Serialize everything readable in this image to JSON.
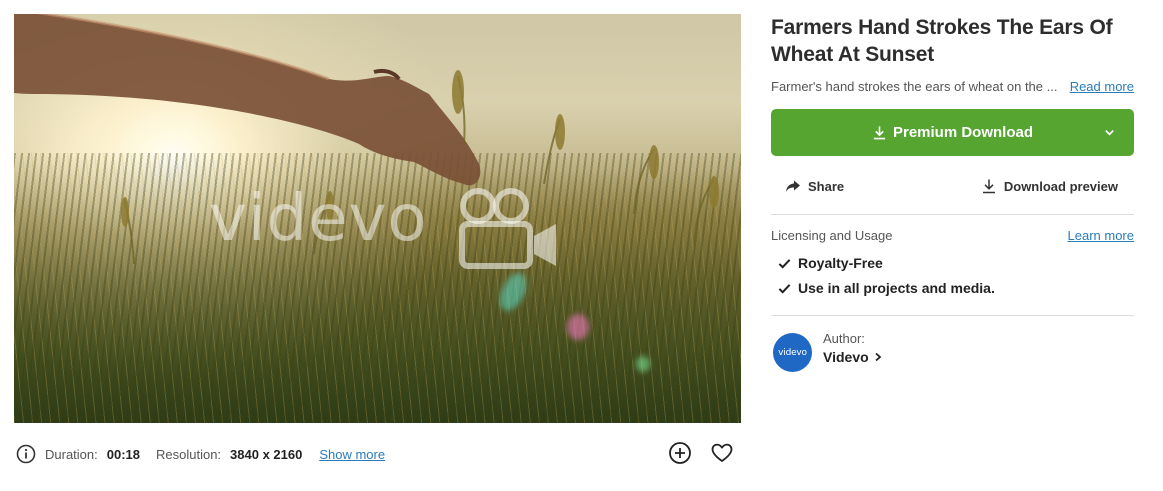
{
  "media": {
    "watermark": "videvo",
    "image_description_icon": "video-thumbnail"
  },
  "meta": {
    "duration_label": "Duration:",
    "duration_value": "00:18",
    "resolution_label": "Resolution:",
    "resolution_value": "3840 x 2160",
    "show_more": "Show more",
    "icons": [
      "info-icon",
      "add-circle-icon",
      "heart-icon"
    ]
  },
  "panel": {
    "title": "Farmers Hand Strokes The Ears Of Wheat At Sunset",
    "description": "Farmer's hand strokes the ears of wheat on the ...",
    "read_more": "Read more",
    "premium_download": "Premium Download",
    "share": "Share",
    "download_preview": "Download preview",
    "licensing_title": "Licensing and Usage",
    "learn_more": "Learn more",
    "features": [
      "Royalty-Free",
      "Use in all projects and media."
    ],
    "author_label": "Author:",
    "author_name": "Videvo",
    "avatar_text": "videvo"
  },
  "colors": {
    "accent_green": "#55a530",
    "link_blue": "#2b7bb9",
    "avatar_blue": "#1f69c4"
  }
}
